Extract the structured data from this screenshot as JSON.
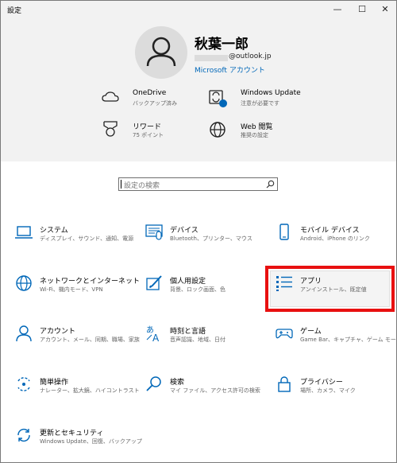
{
  "window": {
    "title": "設定",
    "controls": {
      "minimize": "—",
      "maximize": "☐",
      "close": "✕"
    }
  },
  "account": {
    "name": "秋葉一郎",
    "email_suffix": "@outlook.jp",
    "link": "Microsoft アカウント"
  },
  "quick_items": [
    {
      "icon": "cloud-icon",
      "title": "OneDrive",
      "subtitle": "バックアップ済み"
    },
    {
      "icon": "sync-icon",
      "title": "Windows Update",
      "subtitle": "注意が必要です"
    },
    {
      "icon": "medal-icon",
      "title": "リワード",
      "subtitle": "75 ポイント"
    },
    {
      "icon": "globe-icon",
      "title": "Web 閲覧",
      "subtitle": "推奨の設定"
    }
  ],
  "search": {
    "placeholder": "設定の検索"
  },
  "categories": [
    {
      "icon": "laptop-icon",
      "title": "システム",
      "subtitle": "ディスプレイ、サウンド、通知、電源"
    },
    {
      "icon": "devices-icon",
      "title": "デバイス",
      "subtitle": "Bluetooth、プリンター、マウス"
    },
    {
      "icon": "phone-icon",
      "title": "モバイル デバイス",
      "subtitle": "Android、iPhone のリンク"
    },
    {
      "icon": "globe-network-icon",
      "title": "ネットワークとインターネット",
      "subtitle": "Wi-Fi、機内モード、VPN"
    },
    {
      "icon": "personalization-icon",
      "title": "個人用設定",
      "subtitle": "背景、ロック画面、色"
    },
    {
      "icon": "apps-icon",
      "title": "アプリ",
      "subtitle": "アンインストール、既定値"
    },
    {
      "icon": "person-icon",
      "title": "アカウント",
      "subtitle": "アカウント、メール、同期、職場、家族"
    },
    {
      "icon": "language-icon",
      "title": "時刻と言語",
      "subtitle": "音声認識、地域、日付"
    },
    {
      "icon": "gamepad-icon",
      "title": "ゲーム",
      "subtitle": "Game Bar、キャプチャ、ゲーム モード"
    },
    {
      "icon": "ease-of-access-icon",
      "title": "簡単操作",
      "subtitle": "ナレーター、拡大鏡、ハイコントラスト"
    },
    {
      "icon": "search-icon",
      "title": "検索",
      "subtitle": "マイ ファイル、アクセス許可の検索"
    },
    {
      "icon": "lock-icon",
      "title": "プライバシー",
      "subtitle": "場所、カメラ、マイク"
    },
    {
      "icon": "update-icon",
      "title": "更新とセキュリティ",
      "subtitle": "Windows Update、回復、バックアップ"
    }
  ],
  "colors": {
    "accent": "#0067b8",
    "highlight": "#e81010",
    "header_bg": "#f2f2f2"
  }
}
